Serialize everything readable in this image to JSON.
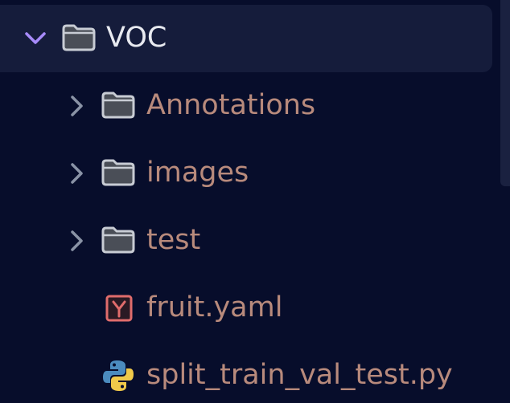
{
  "explorer": {
    "root": {
      "label": "VOC",
      "expanded": true,
      "icon": "folder-icon"
    },
    "children": [
      {
        "label": "Annotations",
        "type": "folder",
        "expanded": false,
        "icon": "folder-icon"
      },
      {
        "label": "images",
        "type": "folder",
        "expanded": false,
        "icon": "folder-icon"
      },
      {
        "label": "test",
        "type": "folder",
        "expanded": false,
        "icon": "folder-icon"
      },
      {
        "label": "fruit.yaml",
        "type": "file",
        "icon": "yaml-file-icon"
      },
      {
        "label": "split_train_val_test.py",
        "type": "file",
        "icon": "python-file-icon"
      }
    ]
  },
  "colors": {
    "background": "#070d2b",
    "selected_row": "#151c3b",
    "root_label": "#e8eaf0",
    "child_label": "#b88a7c",
    "root_chevron": "#a78bfa",
    "child_chevron": "#8a93a6",
    "folder_fill": "#4a4e57",
    "folder_stroke": "#c8ccd4",
    "yaml_accent": "#e06c6c",
    "python_blue": "#4b8bbe",
    "python_yellow": "#f0c94a"
  }
}
